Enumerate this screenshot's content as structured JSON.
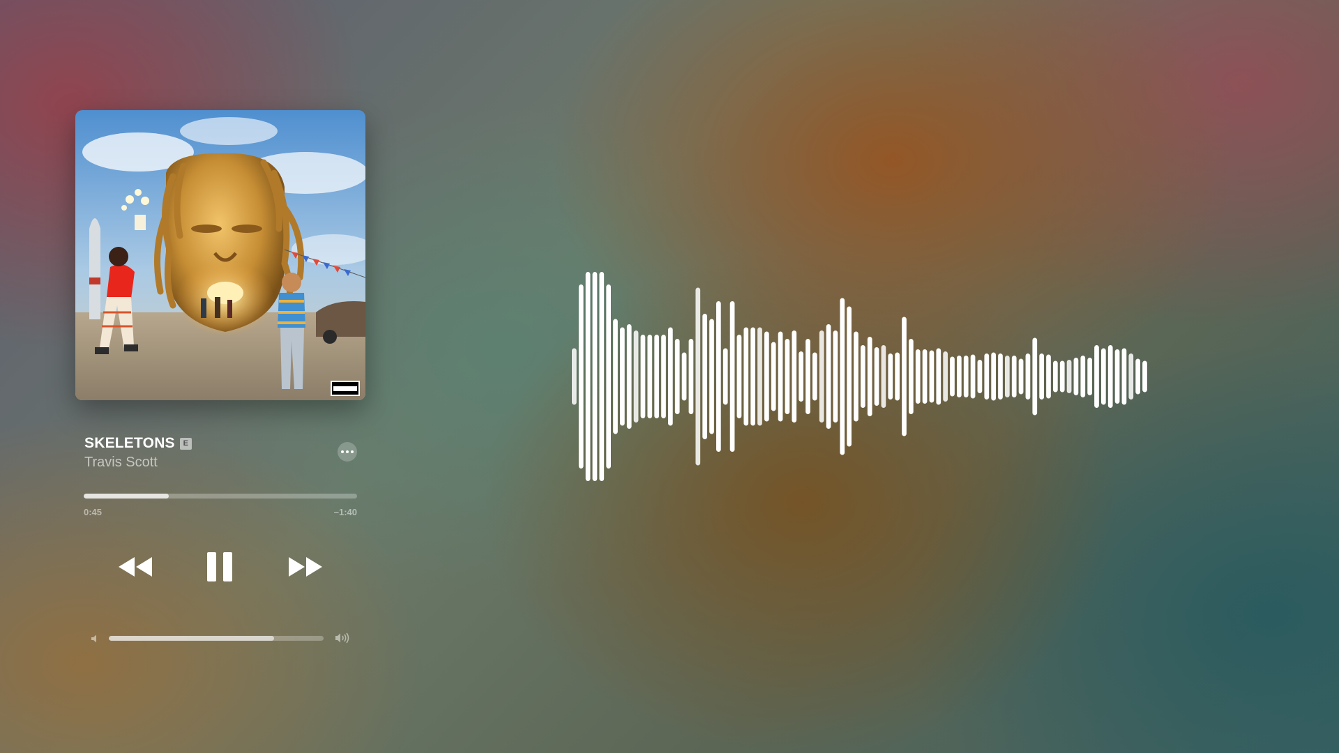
{
  "track": {
    "title": "SKELETONS",
    "explicit_badge": "E",
    "artist": "Travis Scott"
  },
  "playback": {
    "elapsed": "0:45",
    "remaining": "–1:40",
    "progress_fraction": 0.31,
    "state": "playing"
  },
  "volume": {
    "level_fraction": 0.77
  },
  "album_art": {
    "advisory_label": "PARENTAL ADVISORY EXPLICIT CONTENT"
  },
  "icons": {
    "more": "more-options-icon",
    "previous": "rewind-icon",
    "pause": "pause-icon",
    "next": "fast-forward-icon",
    "volume_low": "speaker-low-icon",
    "volume_high": "speaker-high-icon"
  },
  "waveform": {
    "amplitudes": [
      0.27,
      0.88,
      1.0,
      1.0,
      1.0,
      0.88,
      0.55,
      0.47,
      0.5,
      0.44,
      0.4,
      0.4,
      0.4,
      0.4,
      0.47,
      0.36,
      0.23,
      0.36,
      0.85,
      0.6,
      0.55,
      0.72,
      0.27,
      0.72,
      0.4,
      0.47,
      0.47,
      0.47,
      0.43,
      0.33,
      0.43,
      0.36,
      0.44,
      0.24,
      0.36,
      0.23,
      0.44,
      0.5,
      0.44,
      0.75,
      0.67,
      0.43,
      0.3,
      0.38,
      0.28,
      0.3,
      0.22,
      0.23,
      0.57,
      0.36,
      0.26,
      0.26,
      0.25,
      0.27,
      0.24,
      0.19,
      0.2,
      0.2,
      0.21,
      0.16,
      0.22,
      0.23,
      0.22,
      0.2,
      0.2,
      0.17,
      0.22,
      0.37,
      0.22,
      0.21,
      0.15,
      0.15,
      0.16,
      0.18,
      0.2,
      0.18,
      0.3,
      0.27,
      0.3,
      0.26,
      0.27,
      0.22,
      0.17,
      0.15
    ]
  },
  "colors": {
    "accent": "#ffffff",
    "bar_track": "rgba(255,255,255,0.28)"
  }
}
